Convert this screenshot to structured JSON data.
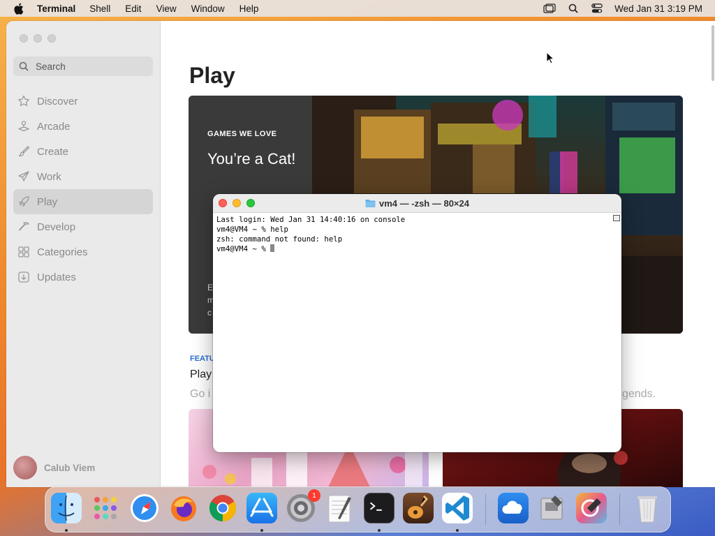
{
  "menubar": {
    "app_name": "Terminal",
    "menus": [
      "Shell",
      "Edit",
      "View",
      "Window",
      "Help"
    ],
    "clock": "Wed Jan 31  3:19 PM",
    "right_icons": [
      "screen-mirroring-icon",
      "spotlight-search-icon",
      "control-center-icon"
    ]
  },
  "appstore": {
    "search_placeholder": "Search",
    "nav": [
      {
        "label": "Discover",
        "icon": "star-icon"
      },
      {
        "label": "Arcade",
        "icon": "joystick-icon"
      },
      {
        "label": "Create",
        "icon": "brush-icon"
      },
      {
        "label": "Work",
        "icon": "paper-plane-icon"
      },
      {
        "label": "Play",
        "icon": "rocket-icon",
        "active": true
      },
      {
        "label": "Develop",
        "icon": "hammer-icon"
      },
      {
        "label": "Categories",
        "icon": "grid-icon"
      },
      {
        "label": "Updates",
        "icon": "download-icon"
      }
    ],
    "user_name": "Calub Viem",
    "page_title": "Play",
    "hero": {
      "eyebrow": "GAMES WE LOVE",
      "headline": "You’re a Cat!",
      "desc": "E\nm\nc"
    },
    "featured": {
      "eyebrow": "FEATU",
      "title": "Play",
      "subtitle": "Go i",
      "subtitle_right": "gends."
    }
  },
  "terminal": {
    "title": "vm4 — -zsh — 80×24",
    "lines": [
      "Last login: Wed Jan 31 14:40:16 on console",
      "vm4@VM4 ~ % help",
      "zsh: command not found: help",
      "vm4@VM4 ~ % "
    ]
  },
  "dock": {
    "apps": [
      {
        "name": "Finder",
        "icon": "finder-icon",
        "running": true
      },
      {
        "name": "Launchpad",
        "icon": "launchpad-icon"
      },
      {
        "name": "Safari",
        "icon": "safari-icon"
      },
      {
        "name": "Firefox",
        "icon": "firefox-icon"
      },
      {
        "name": "Chrome",
        "icon": "chrome-icon"
      },
      {
        "name": "App Store",
        "icon": "app-store-icon",
        "running": true
      },
      {
        "name": "System Settings",
        "icon": "system-settings-icon",
        "badge": "1"
      },
      {
        "name": "TextEdit",
        "icon": "textedit-icon"
      },
      {
        "name": "Terminal",
        "icon": "terminal-icon",
        "running": true
      },
      {
        "name": "GarageBand",
        "icon": "garageband-icon"
      },
      {
        "name": "Visual Studio Code",
        "icon": "vscode-icon",
        "running": true
      },
      {
        "name": "iCloud Drive",
        "icon": "icloud-icon"
      },
      {
        "name": "Utility",
        "icon": "utility-icon"
      },
      {
        "name": "Color Picker",
        "icon": "color-picker-icon"
      },
      {
        "name": "Trash",
        "icon": "trash-icon"
      }
    ]
  }
}
